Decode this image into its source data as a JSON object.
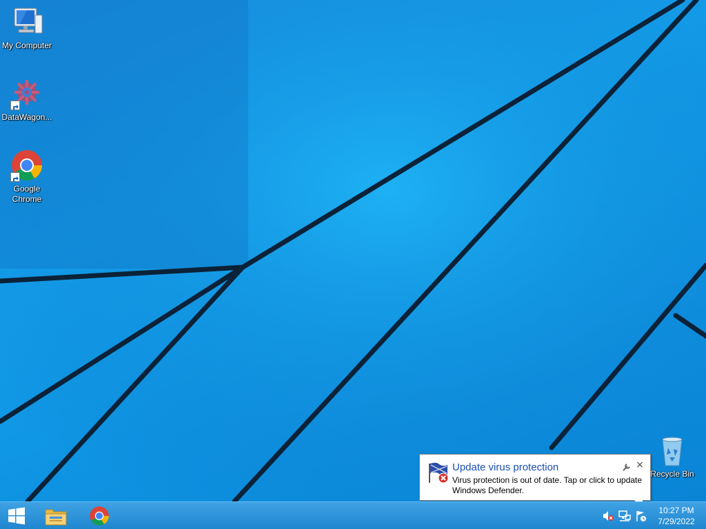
{
  "desktop": {
    "icons": [
      {
        "label": "My Computer"
      },
      {
        "label": "DataWagon..."
      },
      {
        "label": "Google\nChrome"
      },
      {
        "label": "Recycle Bin"
      }
    ]
  },
  "taskbar": {
    "pinned": [
      {
        "icon": "windows-logo-icon",
        "tooltip": "Start"
      },
      {
        "icon": "file-explorer-icon"
      },
      {
        "icon": "chrome-icon"
      }
    ],
    "tray": {
      "icons": [
        "speaker-muted-icon",
        "network-icon",
        "action-center-flag-icon"
      ],
      "time": "10:27 PM",
      "date": "7/29/2022"
    }
  },
  "notification": {
    "title": "Update virus protection",
    "body": "Virus protection is out of date. Tap or click to update Windows Defender.",
    "icon": "defender-warning-flag-icon",
    "close_label": "×",
    "options_icon": "wrench-icon"
  },
  "colors": {
    "desktop_background": "#1497e6",
    "taskbar": "#2a8fd8",
    "notification_title": "#1a4fb5"
  }
}
